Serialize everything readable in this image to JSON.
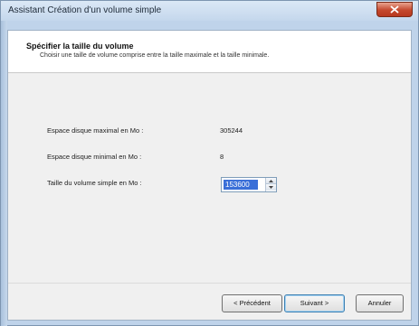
{
  "window": {
    "title": "Assistant Création d'un volume simple",
    "close_icon": "close-icon"
  },
  "header": {
    "title": "Spécifier la taille du volume",
    "subtitle": "Choisir une taille de volume comprise entre la taille maximale et la taille minimale."
  },
  "fields": {
    "max_label": "Espace disque maximal en Mo :",
    "max_value": "305244",
    "min_label": "Espace disque minimal en Mo :",
    "min_value": "8",
    "size_label": "Taille du volume simple en Mo :",
    "size_value": "153600"
  },
  "buttons": {
    "previous": "< Précédent",
    "next": "Suivant >",
    "cancel": "Annuler"
  },
  "colors": {
    "selection": "#3a6fd8",
    "close_button": "#c4482d"
  }
}
